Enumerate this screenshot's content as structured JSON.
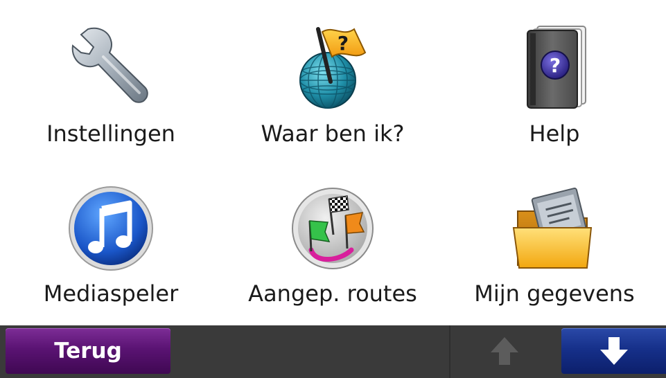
{
  "menu": {
    "items": [
      {
        "label": "Instellingen",
        "icon": "wrench-icon"
      },
      {
        "label": "Waar ben ik?",
        "icon": "globe-question-flag-icon"
      },
      {
        "label": "Help",
        "icon": "help-book-icon"
      },
      {
        "label": "Mediaspeler",
        "icon": "music-note-icon"
      },
      {
        "label": "Aangep. routes",
        "icon": "custom-routes-flags-icon"
      },
      {
        "label": "Mijn gegevens",
        "icon": "folder-documents-icon"
      }
    ]
  },
  "bottombar": {
    "back_label": "Terug",
    "up_icon": "arrow-up-icon",
    "down_icon": "arrow-down-icon",
    "back_color": "#5a1373",
    "down_color": "#16308a"
  }
}
